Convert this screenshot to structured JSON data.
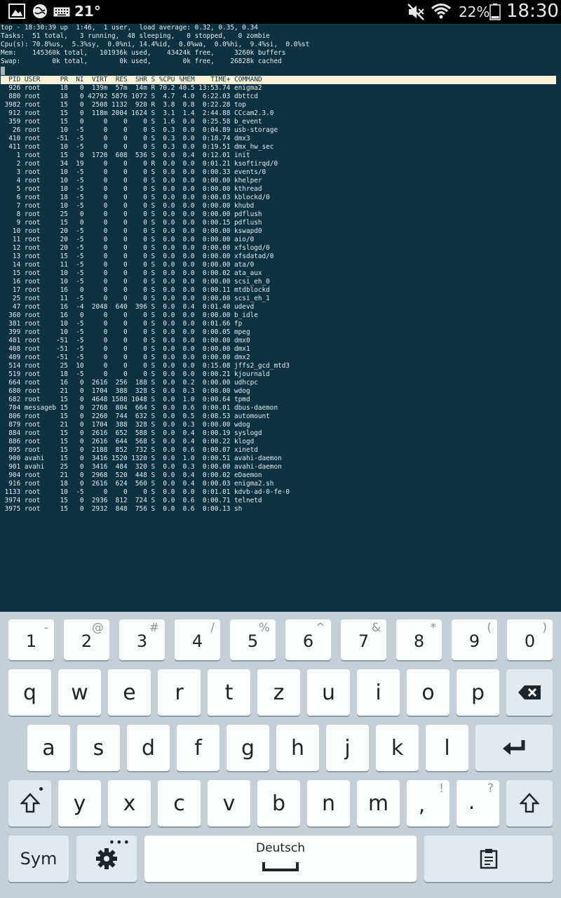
{
  "statusbar": {
    "temperature": "21°",
    "battery_percent": "22%",
    "clock": "18:30",
    "icons": [
      "gallery-icon",
      "globe-icon",
      "keyboard-icon",
      "mute-icon",
      "wifi-icon",
      "battery-icon"
    ]
  },
  "terminal": {
    "summary": [
      "top - 18:30:39 up  1:46,  1 user,  load average: 0.32, 0.35, 0.34",
      "Tasks:  51 total,   3 running,  48 sleeping,   0 stopped,   0 zombie",
      "Cpu(s): 70.8%us,  5.3%sy,  0.0%ni, 14.4%id,  0.0%wa,  0.0%hi,  9.4%si,  0.0%st",
      "Mem:    145360k total,   101936k used,    43424k free,     3260k buffers",
      "Swap:        0k total,        0k used,        0k free,    26828k cached"
    ],
    "columns": [
      "PID",
      "USER",
      "PR",
      "NI",
      "VIRT",
      "RES",
      "SHR",
      "S",
      "%CPU",
      "%MEM",
      "TIME+",
      "COMMAND"
    ],
    "processes": [
      [
        "926",
        "root",
        "18",
        "0",
        "139m",
        "57m",
        "14m",
        "R",
        "70.2",
        "40.5",
        "13:53.74",
        "enigma2"
      ],
      [
        "880",
        "root",
        "18",
        "0",
        "42792",
        "5876",
        "1072",
        "S",
        "4.7",
        "4.0",
        "6:22.03",
        "dbttcd"
      ],
      [
        "3982",
        "root",
        "15",
        "0",
        "2508",
        "1132",
        "920",
        "R",
        "3.8",
        "0.8",
        "0:22.28",
        "top"
      ],
      [
        "912",
        "root",
        "15",
        "0",
        "118m",
        "2004",
        "1624",
        "S",
        "3.1",
        "1.4",
        "2:44.88",
        "CCcam2.3.0"
      ],
      [
        "359",
        "root",
        "15",
        "0",
        "0",
        "0",
        "0",
        "S",
        "1.6",
        "0.0",
        "0:25.58",
        "b_event"
      ],
      [
        "26",
        "root",
        "10",
        "-5",
        "0",
        "0",
        "0",
        "S",
        "0.3",
        "0.0",
        "0:04.89",
        "usb-storage"
      ],
      [
        "410",
        "root",
        "-51",
        "-5",
        "0",
        "0",
        "0",
        "S",
        "0.3",
        "0.0",
        "0:18.74",
        "dmx3"
      ],
      [
        "411",
        "root",
        "10",
        "-5",
        "0",
        "0",
        "0",
        "S",
        "0.3",
        "0.0",
        "0:19.51",
        "dmx_hw_sec"
      ],
      [
        "1",
        "root",
        "15",
        "0",
        "1720",
        "608",
        "536",
        "S",
        "0.0",
        "0.4",
        "0:12.01",
        "init"
      ],
      [
        "2",
        "root",
        "34",
        "19",
        "0",
        "0",
        "0",
        "R",
        "0.0",
        "0.0",
        "0:01.21",
        "ksoftirqd/0"
      ],
      [
        "3",
        "root",
        "10",
        "-5",
        "0",
        "0",
        "0",
        "S",
        "0.0",
        "0.0",
        "0:00.33",
        "events/0"
      ],
      [
        "4",
        "root",
        "10",
        "-5",
        "0",
        "0",
        "0",
        "S",
        "0.0",
        "0.0",
        "0:00.00",
        "khelper"
      ],
      [
        "5",
        "root",
        "10",
        "-5",
        "0",
        "0",
        "0",
        "S",
        "0.0",
        "0.0",
        "0:00.00",
        "kthread"
      ],
      [
        "6",
        "root",
        "18",
        "-5",
        "0",
        "0",
        "0",
        "S",
        "0.0",
        "0.0",
        "0:00.03",
        "kblockd/0"
      ],
      [
        "7",
        "root",
        "10",
        "-5",
        "0",
        "0",
        "0",
        "S",
        "0.0",
        "0.0",
        "0:00.00",
        "khubd"
      ],
      [
        "8",
        "root",
        "25",
        "0",
        "0",
        "0",
        "0",
        "S",
        "0.0",
        "0.0",
        "0:00.00",
        "pdflush"
      ],
      [
        "9",
        "root",
        "15",
        "0",
        "0",
        "0",
        "0",
        "S",
        "0.0",
        "0.0",
        "0:00.15",
        "pdflush"
      ],
      [
        "10",
        "root",
        "20",
        "-5",
        "0",
        "0",
        "0",
        "S",
        "0.0",
        "0.0",
        "0:00.00",
        "kswapd0"
      ],
      [
        "11",
        "root",
        "20",
        "-5",
        "0",
        "0",
        "0",
        "S",
        "0.0",
        "0.0",
        "0:00.00",
        "aio/0"
      ],
      [
        "12",
        "root",
        "20",
        "-5",
        "0",
        "0",
        "0",
        "S",
        "0.0",
        "0.0",
        "0:00.00",
        "xfslogd/0"
      ],
      [
        "13",
        "root",
        "15",
        "-5",
        "0",
        "0",
        "0",
        "S",
        "0.0",
        "0.0",
        "0:00.00",
        "xfsdatad/0"
      ],
      [
        "14",
        "root",
        "11",
        "-5",
        "0",
        "0",
        "0",
        "S",
        "0.0",
        "0.0",
        "0:00.00",
        "ata/0"
      ],
      [
        "15",
        "root",
        "10",
        "-5",
        "0",
        "0",
        "0",
        "S",
        "0.0",
        "0.0",
        "0:00.02",
        "ata_aux"
      ],
      [
        "16",
        "root",
        "10",
        "-5",
        "0",
        "0",
        "0",
        "S",
        "0.0",
        "0.0",
        "0:00.00",
        "scsi_eh_0"
      ],
      [
        "17",
        "root",
        "16",
        "0",
        "0",
        "0",
        "0",
        "S",
        "0.0",
        "0.0",
        "0:00.11",
        "mtdblockd"
      ],
      [
        "25",
        "root",
        "11",
        "-5",
        "0",
        "0",
        "0",
        "S",
        "0.0",
        "0.0",
        "0:00.00",
        "scsi_eh_1"
      ],
      [
        "47",
        "root",
        "16",
        "-4",
        "2048",
        "640",
        "396",
        "S",
        "0.0",
        "0.4",
        "0:01.40",
        "udevd"
      ],
      [
        "360",
        "root",
        "16",
        "0",
        "0",
        "0",
        "0",
        "S",
        "0.0",
        "0.0",
        "0:00.00",
        "b_idle"
      ],
      [
        "381",
        "root",
        "10",
        "-5",
        "0",
        "0",
        "0",
        "S",
        "0.0",
        "0.0",
        "0:01.66",
        "fp"
      ],
      [
        "399",
        "root",
        "10",
        "-5",
        "0",
        "0",
        "0",
        "S",
        "0.0",
        "0.0",
        "0:00.05",
        "mpeg"
      ],
      [
        "401",
        "root",
        "-51",
        "-5",
        "0",
        "0",
        "0",
        "S",
        "0.0",
        "0.0",
        "0:00.00",
        "dmx0"
      ],
      [
        "408",
        "root",
        "-51",
        "-5",
        "0",
        "0",
        "0",
        "S",
        "0.0",
        "0.0",
        "0:00.00",
        "dmx1"
      ],
      [
        "409",
        "root",
        "-51",
        "-5",
        "0",
        "0",
        "0",
        "S",
        "0.0",
        "0.0",
        "0:00.00",
        "dmx2"
      ],
      [
        "514",
        "root",
        "25",
        "10",
        "0",
        "0",
        "0",
        "S",
        "0.0",
        "0.0",
        "0:15.08",
        "jffs2_gcd_mtd3"
      ],
      [
        "519",
        "root",
        "18",
        "-5",
        "0",
        "0",
        "0",
        "S",
        "0.0",
        "0.0",
        "0:00.21",
        "kjournald"
      ],
      [
        "664",
        "root",
        "16",
        "0",
        "2616",
        "256",
        "188",
        "S",
        "0.0",
        "0.2",
        "0:00.00",
        "udhcpc"
      ],
      [
        "680",
        "root",
        "21",
        "0",
        "1704",
        "388",
        "328",
        "S",
        "0.0",
        "0.3",
        "0:00.00",
        "wdog"
      ],
      [
        "682",
        "root",
        "15",
        "0",
        "4648",
        "1508",
        "1048",
        "S",
        "0.0",
        "1.0",
        "0:00.64",
        "tpmd"
      ],
      [
        "704",
        "messageb",
        "15",
        "0",
        "2768",
        "804",
        "664",
        "S",
        "0.0",
        "0.6",
        "0:00.01",
        "dbus-daemon"
      ],
      [
        "806",
        "root",
        "15",
        "0",
        "2260",
        "744",
        "632",
        "S",
        "0.0",
        "0.5",
        "0:08.53",
        "automount"
      ],
      [
        "879",
        "root",
        "21",
        "0",
        "1704",
        "388",
        "328",
        "S",
        "0.0",
        "0.3",
        "0:00.00",
        "wdog"
      ],
      [
        "884",
        "root",
        "15",
        "0",
        "2616",
        "652",
        "588",
        "S",
        "0.0",
        "0.4",
        "0:00.19",
        "syslogd"
      ],
      [
        "886",
        "root",
        "15",
        "0",
        "2616",
        "644",
        "568",
        "S",
        "0.0",
        "0.4",
        "0:00.22",
        "klogd"
      ],
      [
        "895",
        "root",
        "15",
        "0",
        "2188",
        "852",
        "732",
        "S",
        "0.0",
        "0.6",
        "0:00.07",
        "xinetd"
      ],
      [
        "900",
        "avahi",
        "15",
        "0",
        "3416",
        "1520",
        "1320",
        "S",
        "0.0",
        "1.0",
        "0:00.51",
        "avahi-daemon"
      ],
      [
        "901",
        "avahi",
        "25",
        "0",
        "3416",
        "484",
        "320",
        "S",
        "0.0",
        "0.3",
        "0:00.00",
        "avahi-daemon"
      ],
      [
        "904",
        "root",
        "21",
        "0",
        "2968",
        "520",
        "448",
        "S",
        "0.0",
        "0.4",
        "0:00.02",
        "eDaemon"
      ],
      [
        "916",
        "root",
        "18",
        "0",
        "2616",
        "624",
        "560",
        "S",
        "0.0",
        "0.4",
        "0:00.03",
        "enigma2.sh"
      ],
      [
        "1133",
        "root",
        "10",
        "-5",
        "0",
        "0",
        "0",
        "S",
        "0.0",
        "0.0",
        "0:01.01",
        "kdvb-ad-0-fe-0"
      ],
      [
        "3974",
        "root",
        "15",
        "0",
        "2936",
        "812",
        "724",
        "S",
        "0.0",
        "0.6",
        "0:00.71",
        "telnetd"
      ],
      [
        "3975",
        "root",
        "15",
        "0",
        "2932",
        "848",
        "756",
        "S",
        "0.0",
        "0.6",
        "0:00.13",
        "sh"
      ]
    ]
  },
  "keyboard": {
    "number_row": [
      {
        "label": "1",
        "sub": "-"
      },
      {
        "label": "2",
        "sub": "@"
      },
      {
        "label": "3",
        "sub": "#"
      },
      {
        "label": "4",
        "sub": "/"
      },
      {
        "label": "5",
        "sub": "%"
      },
      {
        "label": "6",
        "sub": "^"
      },
      {
        "label": "7",
        "sub": "&"
      },
      {
        "label": "8",
        "sub": "*"
      },
      {
        "label": "9",
        "sub": "("
      },
      {
        "label": "0",
        "sub": ")"
      }
    ],
    "row1": [
      "q",
      "w",
      "e",
      "r",
      "t",
      "z",
      "u",
      "i",
      "o",
      "p"
    ],
    "row2": [
      "a",
      "s",
      "d",
      "f",
      "g",
      "h",
      "j",
      "k",
      "l"
    ],
    "row3": [
      "y",
      "x",
      "c",
      "v",
      "b",
      "n",
      "m"
    ],
    "comma_key": {
      "label": ",",
      "sub": "!"
    },
    "period_key": {
      "label": ".",
      "sub": "?"
    },
    "sym_label": "Sym",
    "space_language": "Deutsch"
  }
}
